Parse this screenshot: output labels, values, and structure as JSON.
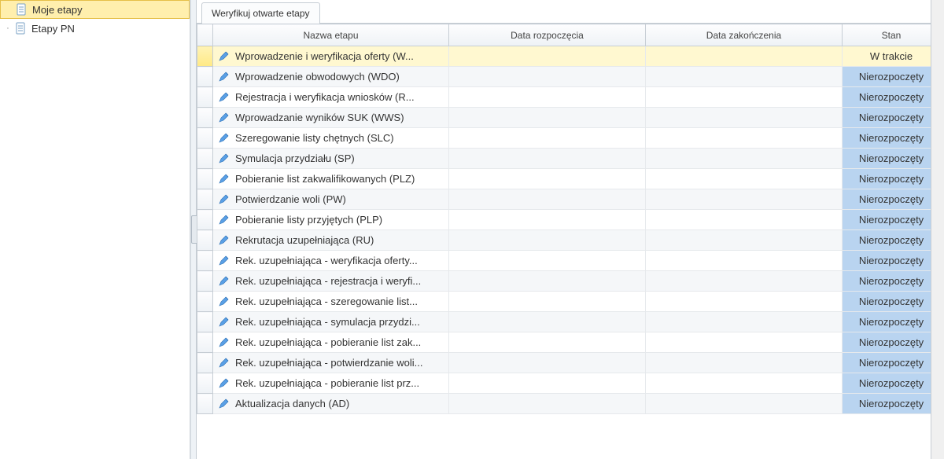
{
  "sidebar": {
    "items": [
      {
        "label": "Moje etapy",
        "selected": true
      },
      {
        "label": "Etapy PN",
        "selected": false
      }
    ]
  },
  "tabs": [
    {
      "label": "Weryfikuj otwarte etapy"
    }
  ],
  "columns": {
    "name": "Nazwa etapu",
    "start": "Data rozpoczęcia",
    "end": "Data zakończenia",
    "status": "Stan"
  },
  "status_labels": {
    "in_progress": "W trakcie",
    "not_started": "Nierozpoczęty"
  },
  "rows": [
    {
      "name": "Wprowadzenie i weryfikacja oferty (W...",
      "start": "",
      "end": "",
      "status": "in_progress",
      "selected": true
    },
    {
      "name": "Wprowadzenie obwodowych (WDO)",
      "start": "",
      "end": "",
      "status": "not_started",
      "selected": false
    },
    {
      "name": "Rejestracja i weryfikacja wniosków (R...",
      "start": "",
      "end": "",
      "status": "not_started",
      "selected": false
    },
    {
      "name": "Wprowadzanie wyników SUK (WWS)",
      "start": "",
      "end": "",
      "status": "not_started",
      "selected": false
    },
    {
      "name": "Szeregowanie listy chętnych (SLC)",
      "start": "",
      "end": "",
      "status": "not_started",
      "selected": false
    },
    {
      "name": "Symulacja przydziału (SP)",
      "start": "",
      "end": "",
      "status": "not_started",
      "selected": false
    },
    {
      "name": "Pobieranie list zakwalifikowanych (PLZ)",
      "start": "",
      "end": "",
      "status": "not_started",
      "selected": false
    },
    {
      "name": "Potwierdzanie woli (PW)",
      "start": "",
      "end": "",
      "status": "not_started",
      "selected": false
    },
    {
      "name": "Pobieranie listy przyjętych (PLP)",
      "start": "",
      "end": "",
      "status": "not_started",
      "selected": false
    },
    {
      "name": "Rekrutacja uzupełniająca (RU)",
      "start": "",
      "end": "",
      "status": "not_started",
      "selected": false
    },
    {
      "name": "Rek. uzupełniająca - weryfikacja oferty...",
      "start": "",
      "end": "",
      "status": "not_started",
      "selected": false
    },
    {
      "name": "Rek. uzupełniająca - rejestracja i weryfi...",
      "start": "",
      "end": "",
      "status": "not_started",
      "selected": false
    },
    {
      "name": "Rek. uzupełniająca - szeregowanie list...",
      "start": "",
      "end": "",
      "status": "not_started",
      "selected": false
    },
    {
      "name": "Rek. uzupełniająca - symulacja przydzi...",
      "start": "",
      "end": "",
      "status": "not_started",
      "selected": false
    },
    {
      "name": "Rek. uzupełniająca - pobieranie list zak...",
      "start": "",
      "end": "",
      "status": "not_started",
      "selected": false
    },
    {
      "name": "Rek. uzupełniająca - potwierdzanie woli...",
      "start": "",
      "end": "",
      "status": "not_started",
      "selected": false
    },
    {
      "name": "Rek. uzupełniająca - pobieranie list prz...",
      "start": "",
      "end": "",
      "status": "not_started",
      "selected": false
    },
    {
      "name": "Aktualizacja danych (AD)",
      "start": "",
      "end": "",
      "status": "not_started",
      "selected": false
    }
  ]
}
